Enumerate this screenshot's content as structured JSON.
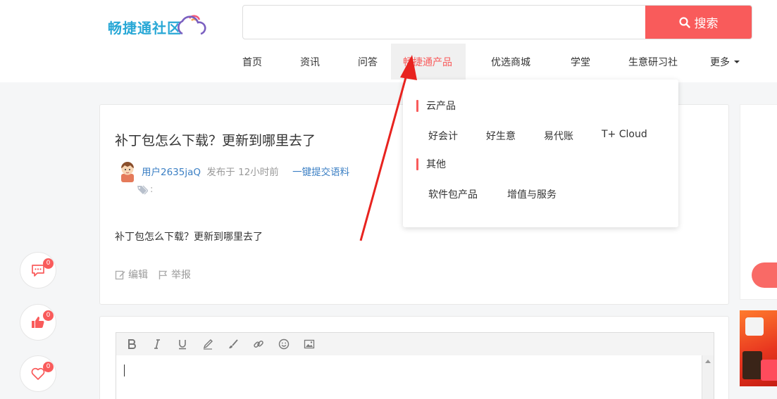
{
  "header": {
    "logo_text": "畅捷通社区",
    "search": {
      "placeholder": "",
      "button_label": "搜索"
    },
    "nav": [
      {
        "label": "首页"
      },
      {
        "label": "资讯"
      },
      {
        "label": "问答"
      },
      {
        "label": "畅捷通产品",
        "active": true
      },
      {
        "label": "优选商城"
      },
      {
        "label": "学堂"
      },
      {
        "label": "生意研习社"
      },
      {
        "label": "更多"
      }
    ]
  },
  "dropdown": {
    "group1_title": "云产品",
    "group1_items": [
      "好会计",
      "好生意",
      "易代账",
      "T+ Cloud"
    ],
    "group2_title": "其他",
    "group2_items": [
      "软件包产品",
      "增值与服务"
    ]
  },
  "question": {
    "title": "补丁包怎么下载？更新到哪里去了",
    "user": "用户2635jaQ",
    "time": "发布于 12小时前",
    "submit_link": "一键提交语料",
    "tags_label": ":",
    "body": "补丁包怎么下载？更新到哪里去了",
    "edit_label": "编辑",
    "report_label": "举报"
  },
  "side_buttons": {
    "comment_count": "0",
    "like_count": "0",
    "favorite_count": "0"
  },
  "colors": {
    "accent": "#f95b5b",
    "link": "#3b7fc4",
    "logo": "#29a8d6"
  }
}
